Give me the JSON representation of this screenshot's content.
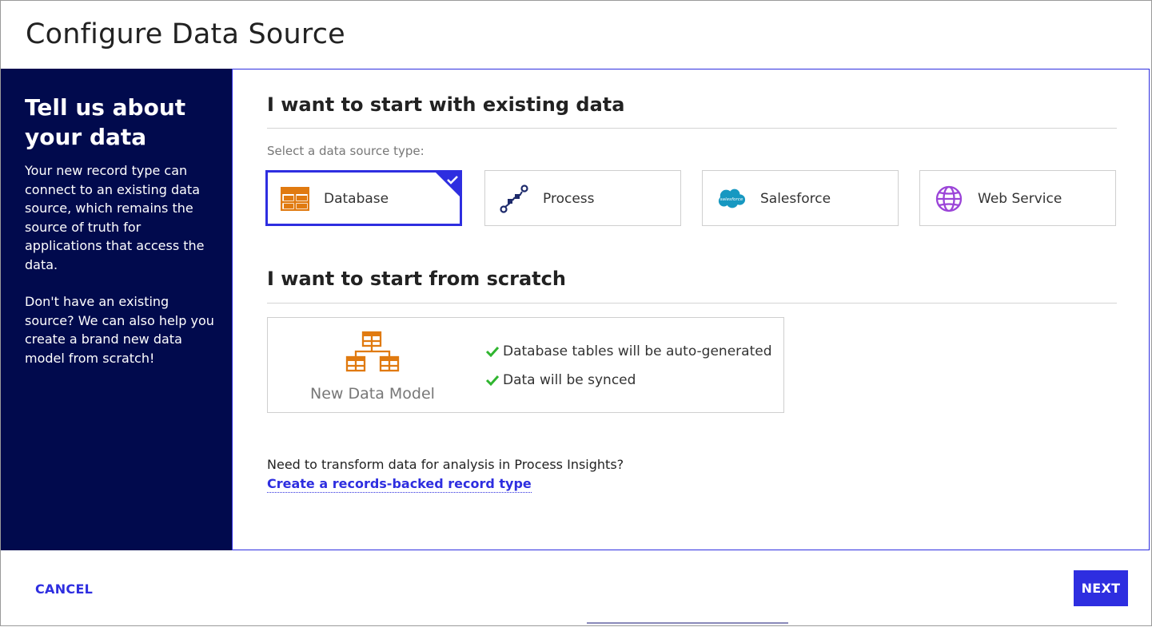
{
  "dialog": {
    "title": "Configure Data Source"
  },
  "sidebar": {
    "heading": "Tell us about your data",
    "paragraph1": "Your new record type can connect to an existing data source, which remains the source of truth for applications that access the data.",
    "paragraph2": "Don't have an existing source? We can also help you create a brand new data model from scratch!",
    "background_color": "#010a4d"
  },
  "existing": {
    "heading": "I want to start with existing data",
    "select_label": "Select a data source type:",
    "options": [
      {
        "label": "Database",
        "icon": "database-icon",
        "selected": true
      },
      {
        "label": "Process",
        "icon": "process-icon",
        "selected": false
      },
      {
        "label": "Salesforce",
        "icon": "salesforce-icon",
        "selected": false
      },
      {
        "label": "Web Service",
        "icon": "globe-icon",
        "selected": false
      }
    ]
  },
  "scratch": {
    "heading": "I want to start from scratch",
    "model_label": "New Data Model",
    "features": [
      "Database tables will be auto-generated",
      "Data will be synced"
    ]
  },
  "transform": {
    "text": "Need to transform data for analysis in Process Insights?",
    "link": "Create a records-backed record type"
  },
  "footer": {
    "cancel_label": "CANCEL",
    "next_label": "NEXT"
  },
  "colors": {
    "accent": "#2e2ee0",
    "orange": "#e07a10",
    "check_green": "#2fb52f",
    "process_navy": "#1d2a6b",
    "salesforce_blue": "#1798c1",
    "globe_purple": "#9b44d8"
  }
}
